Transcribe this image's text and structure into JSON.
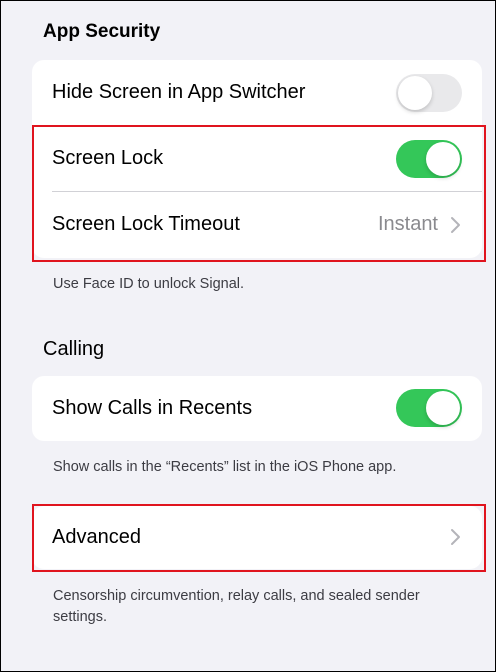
{
  "app_security": {
    "header": "App Security",
    "rows": {
      "hide_screen": {
        "label": "Hide Screen in App Switcher",
        "toggle": "off"
      },
      "screen_lock": {
        "label": "Screen Lock",
        "toggle": "on"
      },
      "screen_lock_timeout": {
        "label": "Screen Lock Timeout",
        "value": "Instant"
      }
    },
    "footer": "Use Face ID to unlock Signal."
  },
  "calling": {
    "header": "Calling",
    "rows": {
      "show_calls": {
        "label": "Show Calls in Recents",
        "toggle": "on"
      }
    },
    "footer": "Show calls in the “Recents” list in the iOS Phone app."
  },
  "advanced": {
    "label": "Advanced",
    "footer": "Censorship circumvention, relay calls, and sealed sender settings."
  },
  "colors": {
    "toggle_on": "#34c759",
    "toggle_off": "#e9e9eb",
    "highlight": "#e0141e",
    "background": "#f2f2f7"
  },
  "icons": [
    "chevron-right-icon"
  ]
}
